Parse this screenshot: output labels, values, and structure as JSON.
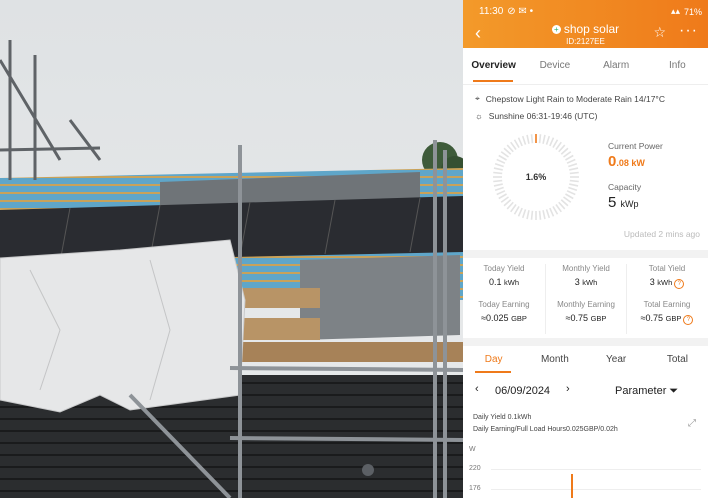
{
  "status_bar": {
    "time": "11:30",
    "battery": "71%"
  },
  "header": {
    "title": "shop solar",
    "subtitle": "ID:2127EE"
  },
  "tabs": [
    "Overview",
    "Device",
    "Alarm",
    "Info"
  ],
  "weather": {
    "forecast": "Chepstow Light Rain to Moderate Rain 14/17°C",
    "sunshine": "Sunshine  06:31-19:46 (UTC)"
  },
  "gauge": {
    "percent_label": "1.6%",
    "fraction": 0.016
  },
  "power": {
    "label": "Current Power",
    "value": "0",
    "value_suffix": ".08 kW"
  },
  "capacity": {
    "label": "Capacity",
    "value": "5",
    "unit": "kWp"
  },
  "updated": "Updated 2 mins ago",
  "yields": [
    {
      "label": "Today Yield",
      "value": "0.1",
      "unit": "kWh"
    },
    {
      "label": "Monthly Yield",
      "value": "3",
      "unit": "kWh"
    },
    {
      "label": "Total Yield",
      "value": "3",
      "unit": "kWh"
    }
  ],
  "earnings": [
    {
      "label": "Today Earning",
      "value": "≈0.025",
      "unit": "GBP"
    },
    {
      "label": "Monthly Earning",
      "value": "≈0.75",
      "unit": "GBP"
    },
    {
      "label": "Total Earning",
      "value": "≈0.75",
      "unit": "GBP"
    }
  ],
  "period_tabs": [
    "Day",
    "Month",
    "Year",
    "Total"
  ],
  "date": "06/09/2024",
  "parameter_label": "Parameter",
  "chart_info": {
    "line1": "Daily Yield 0.1kWh",
    "line2": "Daily Earning/Full Load Hours0.025GBP/0.02h"
  },
  "chart_axis": {
    "unit": "W",
    "tick1": "220",
    "tick2": "176"
  },
  "colors": {
    "accent": "#ef7a1a",
    "header_start": "#f39a2a"
  }
}
